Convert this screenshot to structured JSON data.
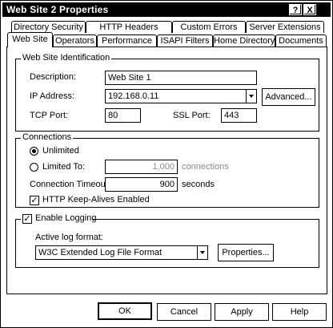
{
  "window": {
    "title": "Web Site 2 Properties",
    "help_button": "?",
    "close_button": "X"
  },
  "tabs": {
    "row_back": [
      "Directory Security",
      "HTTP Headers",
      "Custom Errors",
      "Server Extensions"
    ],
    "row_front": [
      "Web Site",
      "Operators",
      "Performance",
      "ISAPI Filters",
      "Home Directory",
      "Documents"
    ],
    "active": "Web Site"
  },
  "identification": {
    "group_title": "Web Site Identification",
    "description_label": "Description:",
    "description_value": "Web Site 1",
    "ip_label": "IP Address:",
    "ip_value": "192.168.0.11",
    "advanced_button": "Advanced...",
    "tcp_port_label": "TCP Port:",
    "tcp_port_value": "80",
    "ssl_port_label": "SSL Port:",
    "ssl_port_value": "443"
  },
  "connections": {
    "group_title": "Connections",
    "unlimited_label": "Unlimited",
    "unlimited_selected": true,
    "limited_label": "Limited To:",
    "limited_value": "1,000",
    "limited_unit": "connections",
    "timeout_label": "Connection Timeout:",
    "timeout_value": "900",
    "timeout_unit": "seconds",
    "keepalive_label": "HTTP Keep-Alives Enabled",
    "keepalive_checked": true
  },
  "logging": {
    "enable_label": "Enable Logging",
    "enable_checked": true,
    "format_label": "Active log format:",
    "format_value": "W3C Extended Log File Format",
    "properties_button": "Properties..."
  },
  "footer": {
    "ok": "OK",
    "cancel": "Cancel",
    "apply": "Apply",
    "help": "Help"
  }
}
